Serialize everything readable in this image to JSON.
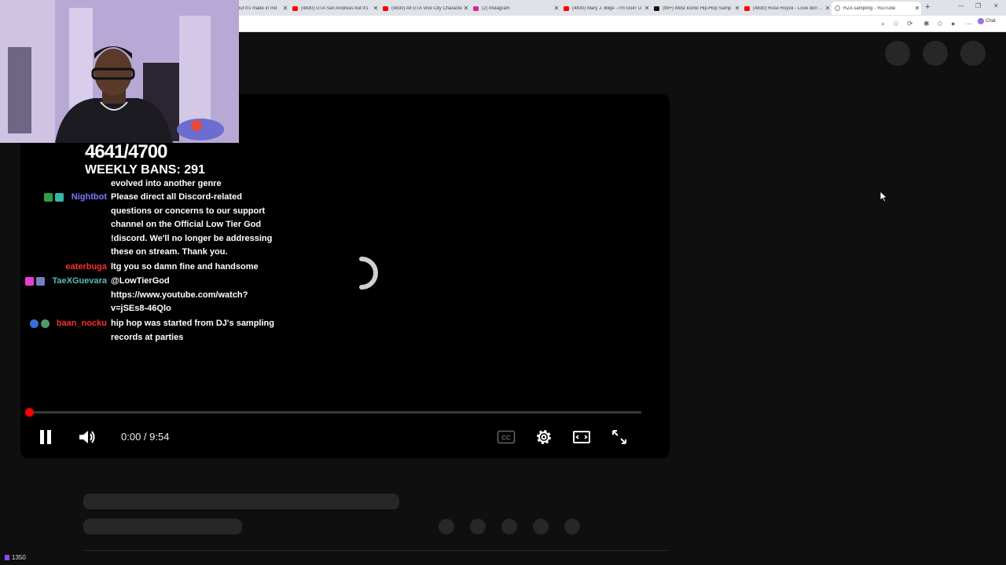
{
  "browser": {
    "tabs": [
      {
        "title": "but it's made in Ind",
        "fav": "youtube-icon",
        "color": "#ff0000"
      },
      {
        "title": "(4830) GTA San Andreas but it's",
        "fav": "youtube-icon",
        "color": "#ff0000"
      },
      {
        "title": "(4830) All GTA Vice City Characte",
        "fav": "youtube-icon",
        "color": "#ff0000"
      },
      {
        "title": "(2) Instagram",
        "fav": "instagram-icon",
        "color": "#d6249f"
      },
      {
        "title": "(4830) Mary J. Blige - I'm Goin' D",
        "fav": "youtube-icon",
        "color": "#ff0000"
      },
      {
        "title": "(99+) Most Iconic Hip-Hop Samp",
        "fav": "tiktok-icon",
        "color": "#111111"
      },
      {
        "title": "(4830) Rose Royce - Love don't B",
        "fav": "youtube-icon",
        "color": "#ff0000"
      },
      {
        "title": "RZA sampling - YouTube",
        "fav": "loading-icon",
        "color": "#888888"
      }
    ],
    "new_tab": "+",
    "chat_label": "Chat"
  },
  "player": {
    "time_current": "0:00",
    "time_separator": " / ",
    "time_total": "9:54",
    "progress": 0,
    "accent": "#ff0000"
  },
  "overlay": {
    "counter": "4641/4700",
    "weekly_bans": "WEEKLY BANS: 291",
    "viewer_count": "1350",
    "chat": [
      {
        "user": "",
        "color": "#ffffff",
        "text": "evolved into another genre",
        "badges": []
      },
      {
        "user": "Nightbot",
        "color": "#7b7bff",
        "text": "Please direct all Discord-related questions or concerns to our support channel on the Official Low Tier God !discord. We'll no longer be addressing these on stream. Thank you.",
        "badges": [
          "verified-badge-icon",
          "moderator-badge-icon"
        ]
      },
      {
        "user": "eaterbuga",
        "color": "#ff2d2d",
        "text": "ltg you so damn fine and handsome",
        "badges": []
      },
      {
        "user": "TaeXGuevara",
        "color": "#5fb8b8",
        "text": "@LowTierGod https://www.youtube.com/watch?v=jSEs8-46Qlo",
        "badges": [
          "subscriber-badge-icon",
          "gift-badge-icon"
        ]
      },
      {
        "user": "baan_nocku",
        "color": "#ff2d2d",
        "text": "hip hop was started from DJ's sampling records at parties",
        "badges": [
          "premium-badge-icon",
          "globe-badge-icon"
        ]
      }
    ]
  }
}
